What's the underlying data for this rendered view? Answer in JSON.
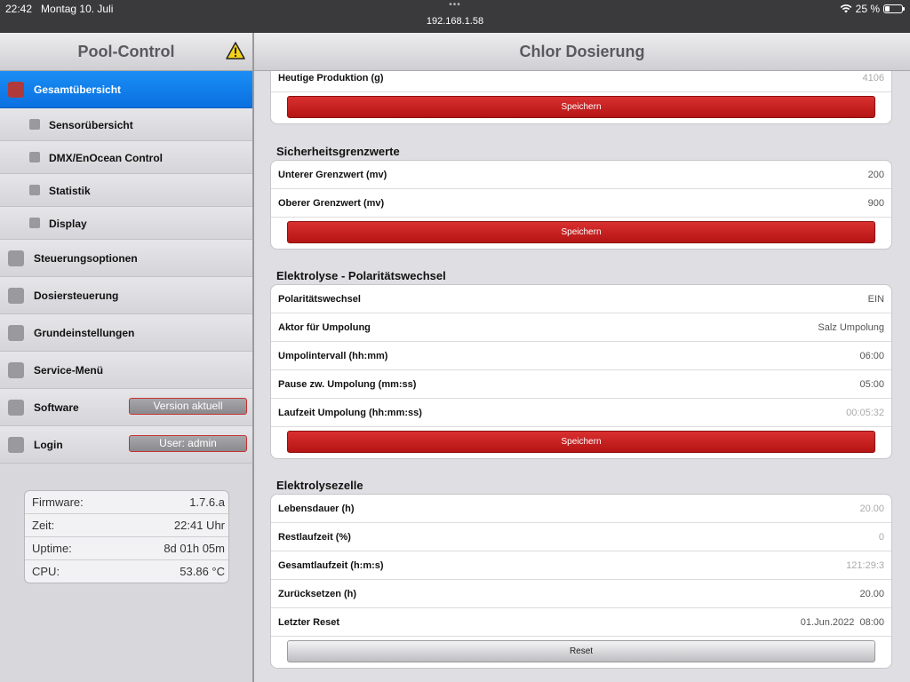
{
  "status_bar": {
    "time": "22:42",
    "date": "Montag 10. Juli",
    "dots": "•••",
    "url": "192.168.1.58",
    "battery": "25 %",
    "battery_level": 0.25
  },
  "sidebar": {
    "title": "Pool-Control",
    "items": [
      {
        "label": "Gesamtübersicht",
        "active": true
      },
      {
        "label": "Sensorübersicht"
      },
      {
        "label": "DMX/EnOcean Control"
      },
      {
        "label": "Statistik"
      },
      {
        "label": "Display"
      },
      {
        "label": "Steuerungsoptionen"
      },
      {
        "label": "Dosiersteuerung"
      },
      {
        "label": "Grundeinstellungen"
      },
      {
        "label": "Service-Menü"
      },
      {
        "label": "Software",
        "button": "Version aktuell"
      },
      {
        "label": "Login",
        "button": "User: admin"
      }
    ],
    "info": [
      {
        "key": "Firmware:",
        "value": "1.7.6.a"
      },
      {
        "key": "Zeit:",
        "value": "22:41 Uhr"
      },
      {
        "key": "Uptime:",
        "value": "8d 01h 05m"
      },
      {
        "key": "CPU:",
        "value": "53.86 °C"
      }
    ]
  },
  "main": {
    "title": "Chlor Dosierung",
    "top_card": {
      "rows": [
        {
          "key": "Heutige Produktion (g)",
          "value": "4106"
        }
      ],
      "button": "Speichern"
    },
    "sections": [
      {
        "title": "Sicherheitsgrenzwerte",
        "rows": [
          {
            "key": "Unterer Grenzwert (mv)",
            "value": "200"
          },
          {
            "key": "Oberer Grenzwert (mv)",
            "value": "900"
          }
        ],
        "button": "Speichern"
      },
      {
        "title": "Elektrolyse - Polaritätswechsel",
        "rows": [
          {
            "key": "Polaritätswechsel",
            "value": "EIN"
          },
          {
            "key": "Aktor für Umpolung",
            "value": "Salz Umpolung"
          },
          {
            "key": "Umpolintervall (hh:mm)",
            "value": "06:00"
          },
          {
            "key": "Pause zw. Umpolung (mm:ss)",
            "value": "05:00"
          },
          {
            "key": "Laufzeit Umpolung (hh:mm:ss)",
            "value": "00:05:32"
          }
        ],
        "button": "Speichern"
      },
      {
        "title": "Elektrolysezelle",
        "rows": [
          {
            "key": "Lebensdauer (h)",
            "value": "20.00"
          },
          {
            "key": "Restlaufzeit (%)",
            "value": "0"
          },
          {
            "key": "Gesamtlaufzeit (h:m:s)",
            "value": "121:29:3"
          },
          {
            "key": "Zurücksetzen (h)",
            "value": "20.00"
          },
          {
            "key": "Letzter Reset",
            "value": "01.Jun.2022  08:00"
          }
        ],
        "button": "Reset"
      }
    ]
  }
}
